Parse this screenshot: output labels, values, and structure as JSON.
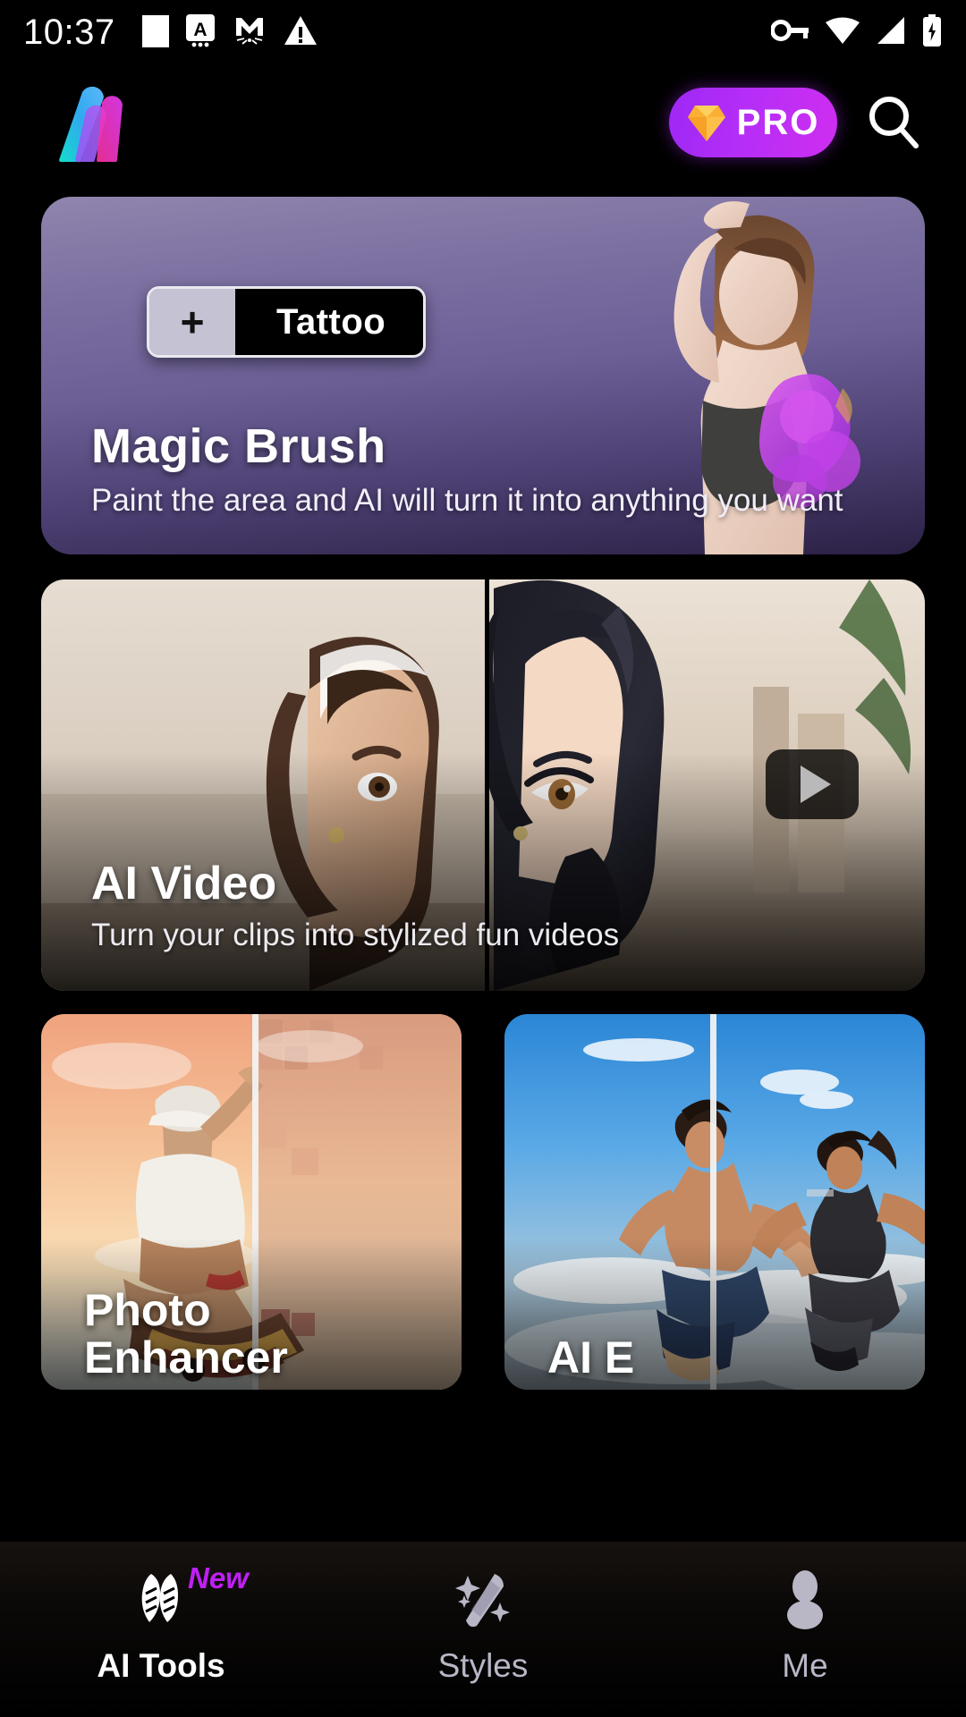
{
  "status_bar": {
    "time": "10:37",
    "left_icons": [
      "blank-notification-icon",
      "a-card-icon",
      "gmail-m-icon",
      "warning-triangle-icon"
    ],
    "right_icons": [
      "vpn-key-icon",
      "wifi-icon",
      "cellular-signal-icon",
      "battery-charging-icon"
    ]
  },
  "header": {
    "logo_name": "meitu-m-logo",
    "pro_label": "PRO",
    "pro_icon": "diamond-icon",
    "search_icon": "search-icon",
    "colors": {
      "pro_gradient_start": "#9d28f5",
      "pro_gradient_end": "#cf2ef0",
      "diamond": "#f9a825",
      "logo_cyan": "#17d3e0",
      "logo_purple": "#7a5cf0",
      "logo_pink": "#f5309a"
    }
  },
  "main": {
    "hero": {
      "title": "Magic Brush",
      "subtitle": "Paint the area and AI will turn it into anything you want",
      "prompt_pill": {
        "plus": "+",
        "label": "Tattoo"
      }
    },
    "cards": [
      {
        "name": "ai-video",
        "title": "AI Video",
        "subtitle": "Turn your clips into stylized fun videos",
        "has_play_button": true
      },
      {
        "name": "photo-enhancer",
        "title": "Photo",
        "title_line2": "Enhancer"
      },
      {
        "name": "ai-eraser",
        "title": "AI E",
        "title_line2": ""
      }
    ]
  },
  "bottom_nav": {
    "items": [
      {
        "label": "AI Tools",
        "icon": "ai-tools-icon",
        "active": true,
        "badge": "New"
      },
      {
        "label": "Styles",
        "icon": "magic-wand-icon",
        "active": false,
        "badge": ""
      },
      {
        "label": "Me",
        "icon": "person-icon",
        "active": false,
        "badge": ""
      }
    ],
    "badge_color": "#c01ff5"
  }
}
